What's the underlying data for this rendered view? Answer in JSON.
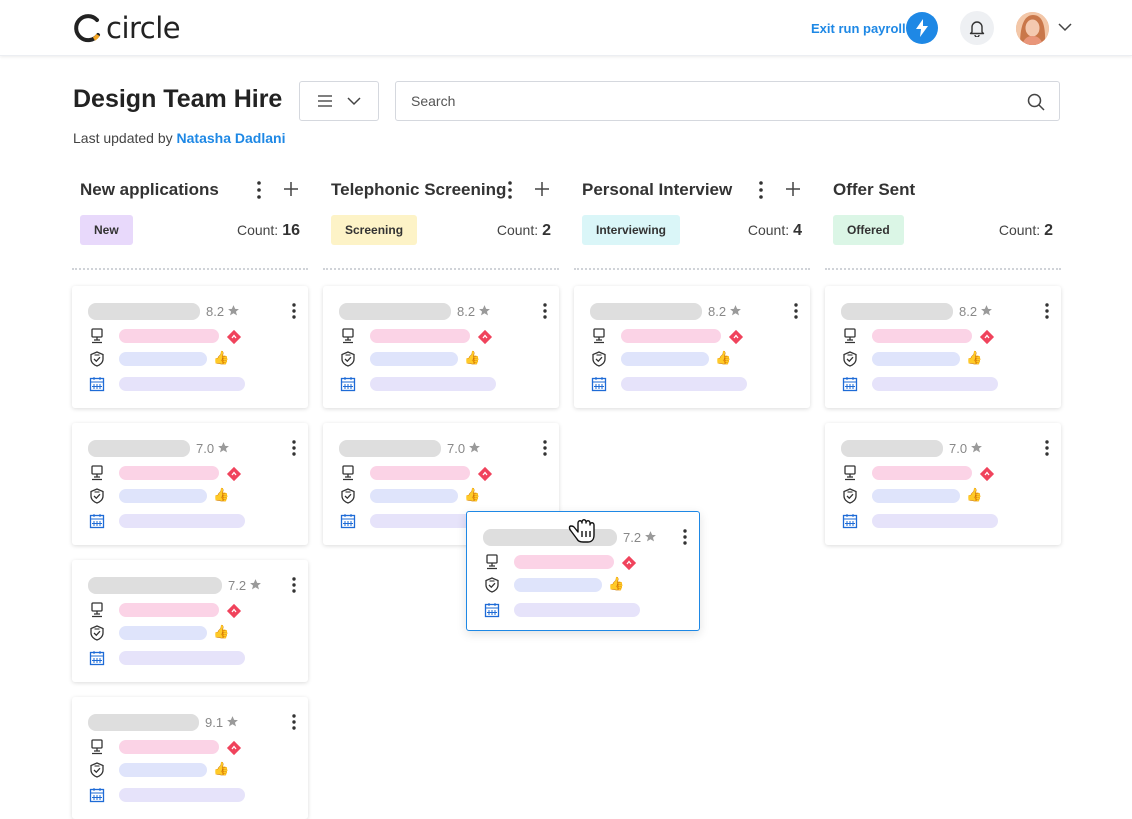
{
  "header": {
    "logo_text": "circle",
    "exit_payroll_label": "Exit run payroll"
  },
  "page": {
    "title": "Design Team Hire",
    "search_placeholder": "Search",
    "last_updated_prefix": "Last updated by",
    "last_updated_user": "Natasha Dadlani"
  },
  "columns": [
    {
      "title": "New applications",
      "badge": "New",
      "badge_color": "#e8d9fb",
      "count_label": "Count:",
      "count": "16",
      "has_actions": true
    },
    {
      "title": "Telephonic Screening",
      "badge": "Screening",
      "badge_color": "#fdf3c7",
      "count_label": "Count:",
      "count": "2",
      "has_actions": true
    },
    {
      "title": "Personal Interview",
      "badge": "Interviewing",
      "badge_color": "#daf6f8",
      "count_label": "Count:",
      "count": "4",
      "has_actions": true
    },
    {
      "title": "Offer Sent",
      "badge": "Offered",
      "badge_color": "#dbf6e6",
      "count_label": "Count:",
      "count": "2",
      "has_actions": false
    }
  ],
  "cards": [
    {
      "col": 0,
      "row": 0,
      "score": "8.2"
    },
    {
      "col": 0,
      "row": 1,
      "score": "7.0"
    },
    {
      "col": 0,
      "row": 2,
      "score": "7.2"
    },
    {
      "col": 0,
      "row": 3,
      "score": "9.1"
    },
    {
      "col": 1,
      "row": 0,
      "score": "8.2"
    },
    {
      "col": 1,
      "row": 1,
      "score": "7.0"
    },
    {
      "col": 2,
      "row": 0,
      "score": "8.2"
    },
    {
      "col": 3,
      "row": 0,
      "score": "8.2"
    },
    {
      "col": 3,
      "row": 1,
      "score": "7.0"
    }
  ],
  "dragging_card": {
    "score": "7.2"
  },
  "colors": {
    "accent": "#1e88e5",
    "diamond": "#f0435c",
    "thumb": "#f6b21b"
  },
  "icons": {
    "card_row1": "monitor-icon",
    "card_row2": "shield-check-icon",
    "card_row3": "calendar-icon"
  }
}
